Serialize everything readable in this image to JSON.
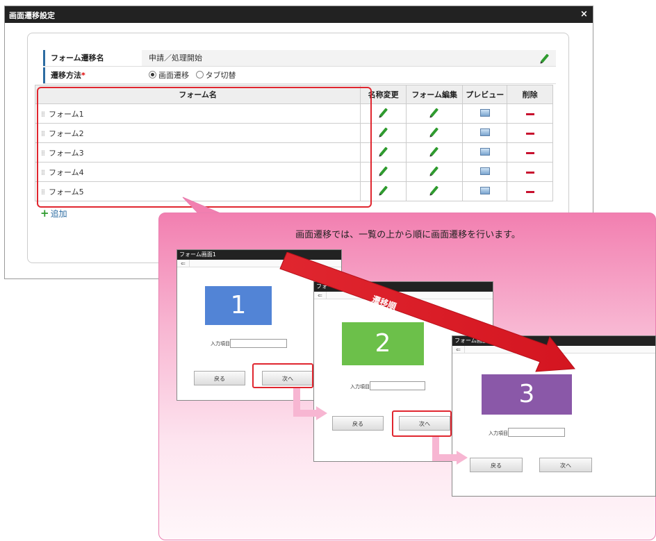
{
  "dialog": {
    "title": "画面遷移設定",
    "close": "×"
  },
  "properties": {
    "name_label": "フォーム遷移名",
    "name_value": "申請／処理開始",
    "method_label": "遷移方法",
    "required_mark": "*",
    "option_screen": "画面遷移",
    "option_tab": "タブ切替",
    "selected_option": "画面遷移"
  },
  "table": {
    "headers": [
      "フォーム名",
      "名称変更",
      "フォーム編集",
      "プレビュー",
      "削除"
    ],
    "rows": [
      "フォーム1",
      "フォーム2",
      "フォーム3",
      "フォーム4",
      "フォーム5"
    ],
    "drag_handle": "⁞⁞"
  },
  "add_link": {
    "icon": "+",
    "label": "追加"
  },
  "callout": {
    "text": "画面遷移では、一覧の上から順に画面遷移を行います。",
    "arrow_label": "遷移順"
  },
  "screens": [
    {
      "title": "フォーム画面1",
      "back": "⇐",
      "number": "1",
      "color": "#5284d6",
      "field_label": "入力項目",
      "back_button": "戻る",
      "next_button": "次へ"
    },
    {
      "title": "フォーム画面2",
      "back": "⇐",
      "number": "2",
      "color": "#6cc04a",
      "field_label": "入力項目",
      "back_button": "戻る",
      "next_button": "次へ"
    },
    {
      "title": "フォーム画面3",
      "back": "⇐",
      "number": "3",
      "color": "#8a58a8",
      "field_label": "入力項目",
      "back_button": "戻る",
      "next_button": "次へ"
    }
  ],
  "colors": {
    "accent": "#2d6ca2",
    "highlight": "#e0262f",
    "edit_icon": "#2f9b2f",
    "delete_icon": "#c8102e",
    "callout_pink": "#f27fb0"
  },
  "icons": {
    "edit": "pencil-icon",
    "preview": "preview-icon",
    "delete": "minus-icon",
    "add": "plus-icon"
  }
}
